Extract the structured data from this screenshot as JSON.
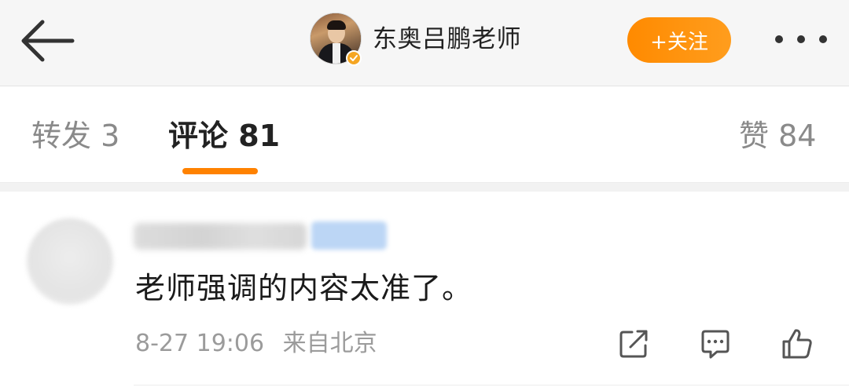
{
  "header": {
    "author_name": "东奥吕鹏老师",
    "follow_label": "+关注",
    "verified_badge_icon": "verified-badge-icon",
    "back_icon": "arrow-left-icon",
    "more_icon": "more-dots-icon"
  },
  "tabs": {
    "repost": "转发 3",
    "comments": "评论 81",
    "likes": "赞 84",
    "active": "comments",
    "accent_color": "#ff8200"
  },
  "comment": {
    "text": "老师强调的内容太准了。",
    "date": "8-27 19:06",
    "location": "来自北京",
    "actions": [
      "share-icon",
      "reply-icon",
      "like-icon"
    ]
  },
  "colors": {
    "follow_button": "#ff8a00",
    "header_bg": "#f6f6f6",
    "muted_text": "#9b9b9b"
  }
}
